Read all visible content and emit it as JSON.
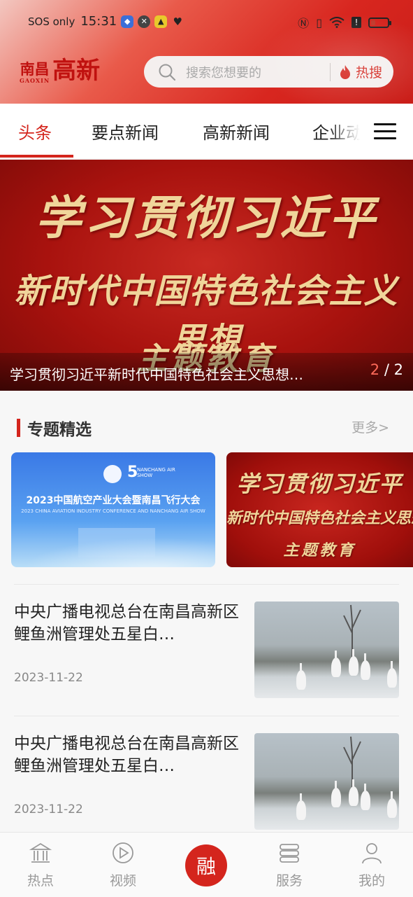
{
  "status_bar": {
    "carrier": "SOS only",
    "time": "15:31",
    "battery_color": "#c0392b"
  },
  "header": {
    "logo_small": "南昌",
    "logo_small_en": "GAOXIN",
    "logo_big": "高新",
    "search_placeholder": "搜索您想要的",
    "hot_search_label": "热搜",
    "brand_color": "#d4251d"
  },
  "tabs": [
    {
      "label": "头条",
      "active": true
    },
    {
      "label": "要点新闻",
      "active": false
    },
    {
      "label": "高新新闻",
      "active": false
    },
    {
      "label": "企业动",
      "active": false
    }
  ],
  "banner": {
    "line1": "学习贯彻习近平",
    "line2": "新时代中国特色社会主义思想",
    "line3": "主题教育",
    "caption": "学习贯彻习近平新时代中国特色社会主义思想…",
    "pager_current": "2",
    "pager_sep": "/",
    "pager_total": "2"
  },
  "section": {
    "title": "专题精选",
    "more": "更多>",
    "topics": [
      {
        "title": "2023中国航空产业大会暨南昌飞行大会",
        "subtitle": "2023 CHINA AVIATION INDUSTRY CONFERENCE AND NANCHANG AIR SHOW",
        "badge_num": "5",
        "badge_text": "NANCHANG AIR SHOW"
      },
      {
        "line1": "学习贯彻习近平",
        "line2": "新时代中国特色社会主义思想",
        "line3": "主题教育"
      }
    ]
  },
  "news": [
    {
      "title": "中央广播电视总台在南昌高新区鲤鱼洲管理处五星白…",
      "date": "2023-11-22"
    },
    {
      "title": "中央广播电视总台在南昌高新区鲤鱼洲管理处五星白…",
      "date": "2023-11-22"
    }
  ],
  "tabbar": {
    "items": [
      {
        "label": "热点",
        "icon": "building-icon"
      },
      {
        "label": "视频",
        "icon": "play-icon"
      },
      {
        "label": "融",
        "icon": "center-logo"
      },
      {
        "label": "服务",
        "icon": "list-icon"
      },
      {
        "label": "我的",
        "icon": "user-icon"
      }
    ]
  }
}
